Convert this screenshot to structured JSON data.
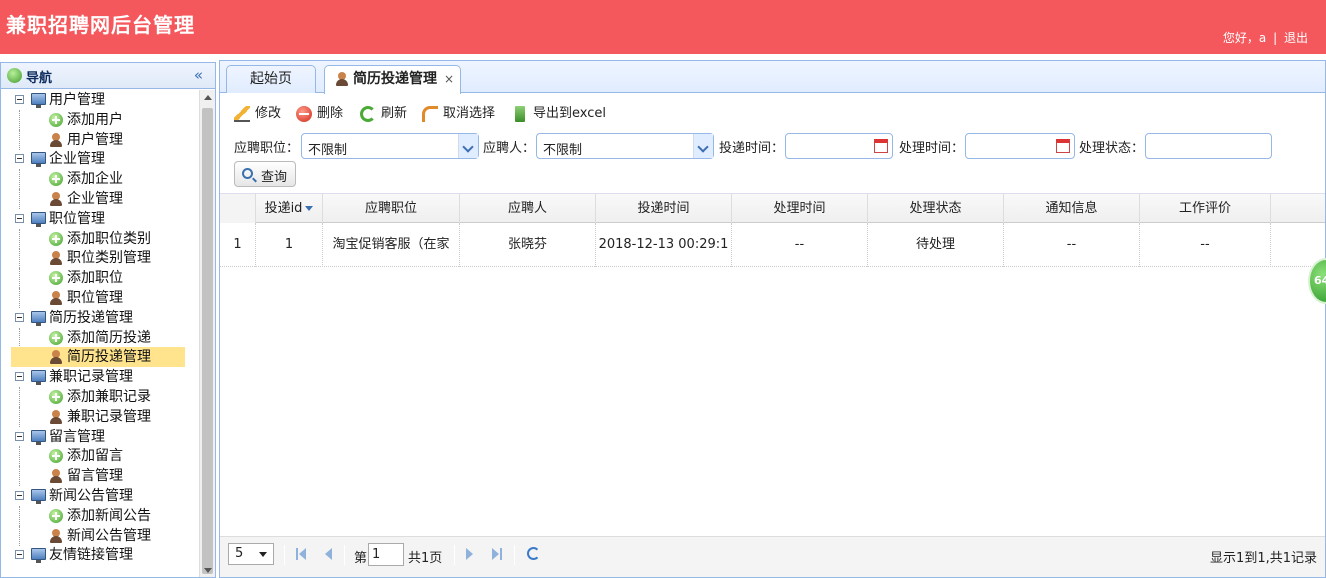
{
  "header": {
    "title": "兼职招聘网后台管理",
    "greeting": "您好，a",
    "separator": "|",
    "logout": "退出"
  },
  "sidebar": {
    "title": "导航",
    "groups": [
      {
        "label": "用户管理",
        "items": [
          "添加用户",
          "用户管理"
        ]
      },
      {
        "label": "企业管理",
        "items": [
          "添加企业",
          "企业管理"
        ]
      },
      {
        "label": "职位管理",
        "items": [
          "添加职位类别",
          "职位类别管理",
          "添加职位",
          "职位管理"
        ]
      },
      {
        "label": "简历投递管理",
        "items": [
          "添加简历投递",
          "简历投递管理"
        ]
      },
      {
        "label": "兼职记录管理",
        "items": [
          "添加兼职记录",
          "兼职记录管理"
        ]
      },
      {
        "label": "留言管理",
        "items": [
          "添加留言",
          "留言管理"
        ]
      },
      {
        "label": "新闻公告管理",
        "items": [
          "添加新闻公告",
          "新闻公告管理"
        ]
      },
      {
        "label": "友情链接管理",
        "items": []
      }
    ]
  },
  "tabs": [
    {
      "label": "起始页"
    },
    {
      "label": "简历投递管理",
      "close": "×"
    }
  ],
  "toolbar": {
    "edit": "修改",
    "delete": "删除",
    "refresh": "刷新",
    "unselect": "取消选择",
    "export": "导出到excel"
  },
  "filters": {
    "position_label": "应聘职位：",
    "position_value": "不限制",
    "applicant_label": "应聘人：",
    "applicant_value": "不限制",
    "submit_time_label": "投递时间：",
    "handle_time_label": "处理时间：",
    "status_label": "处理状态："
  },
  "search": {
    "label": "查询"
  },
  "grid": {
    "columns": [
      "投递id",
      "应聘职位",
      "应聘人",
      "投递时间",
      "处理时间",
      "处理状态",
      "通知信息",
      "工作评价"
    ],
    "rows": [
      {
        "rownum": "1",
        "cells": [
          "1",
          "淘宝促销客服（在家",
          "张晓芬",
          "2018-12-13 00:29:1",
          "--",
          "待处理",
          "--",
          "--"
        ]
      }
    ]
  },
  "pager": {
    "page_size": "5",
    "page_prefix": "第",
    "page_value": "1",
    "page_total": "共1页",
    "info": "显示1到1,共1记录"
  },
  "float_widget": {
    "label": "64"
  },
  "colors": {
    "header_bg": "#f5585c",
    "border": "#95b8e7",
    "selected": "#ffe48d"
  }
}
